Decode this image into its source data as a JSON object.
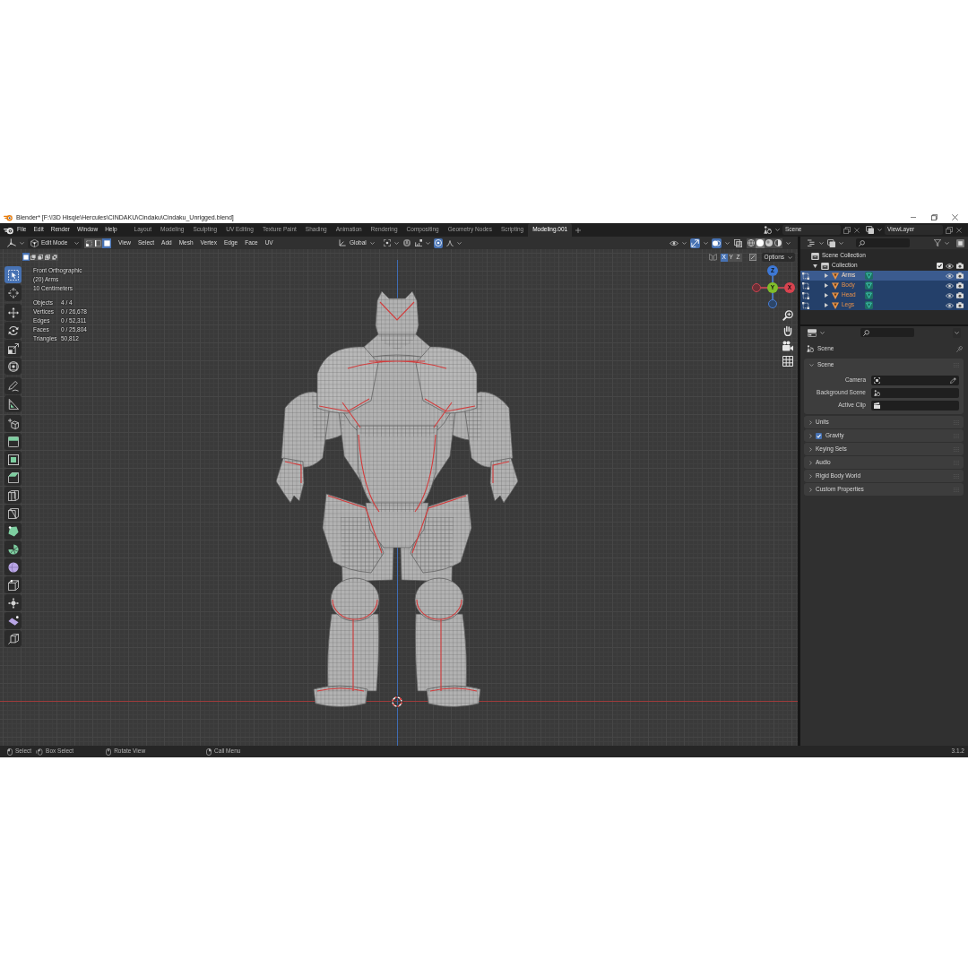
{
  "window": {
    "title": "Blender* [F:\\!3D Hisqie\\Hercules\\CINDAKU\\Cindaku\\Cindaku_Unrigged.blend]"
  },
  "menu_bar": [
    "File",
    "Edit",
    "Render",
    "Window",
    "Help"
  ],
  "workspace_tabs": [
    {
      "label": "Layout",
      "selected": false
    },
    {
      "label": "Modeling",
      "selected": false
    },
    {
      "label": "Sculpting",
      "selected": false
    },
    {
      "label": "UV Editing",
      "selected": false
    },
    {
      "label": "Texture Paint",
      "selected": false
    },
    {
      "label": "Shading",
      "selected": false
    },
    {
      "label": "Animation",
      "selected": false
    },
    {
      "label": "Rendering",
      "selected": false
    },
    {
      "label": "Compositing",
      "selected": false
    },
    {
      "label": "Geometry Nodes",
      "selected": false
    },
    {
      "label": "Scripting",
      "selected": false
    },
    {
      "label": "Modeling.001",
      "selected": true
    }
  ],
  "scene_selector": {
    "value": "Scene"
  },
  "view_layer_selector": {
    "value": "ViewLayer"
  },
  "viewport_header": {
    "mode": "Edit Mode",
    "select_modes": [
      {
        "selected": false
      },
      {
        "selected": false
      },
      {
        "selected": true
      }
    ],
    "menus": [
      "View",
      "Select",
      "Add",
      "Mesh",
      "Vertex",
      "Edge",
      "Face",
      "UV"
    ],
    "transform_orientation": "Global",
    "snap": {
      "on": false
    },
    "proportional_editing": {
      "on": true
    },
    "gizmos": {
      "on": true
    },
    "overlays": {
      "on": true
    },
    "xray": {
      "on": false
    },
    "shading_modes": [
      {
        "selected": false
      },
      {
        "selected": true
      },
      {
        "selected": false
      },
      {
        "selected": false
      }
    ]
  },
  "tool_header": {
    "selection_modes": [
      {
        "selected": true
      },
      {
        "selected": false
      },
      {
        "selected": false
      },
      {
        "selected": false
      },
      {
        "selected": false
      }
    ],
    "mirror_axes": [
      {
        "label": "X",
        "selected": true
      },
      {
        "label": "Y",
        "selected": false
      },
      {
        "label": "Z",
        "selected": false
      }
    ],
    "options": "Options"
  },
  "viewport_info": {
    "view": "Front Orthographic",
    "object": "(20) Arms",
    "grid_scale": "10 Centimeters",
    "stats": [
      {
        "label": "Objects",
        "value": "4 / 4"
      },
      {
        "label": "Vertices",
        "value": "0 / 26,678"
      },
      {
        "label": "Edges",
        "value": "0 / 52,311"
      },
      {
        "label": "Faces",
        "value": "0 / 25,804"
      },
      {
        "label": "Triangles",
        "value": "50,812"
      }
    ]
  },
  "toolbar": [
    {
      "selected": true
    },
    {
      "selected": false
    },
    {
      "selected": false
    },
    {
      "selected": false
    },
    {
      "selected": false
    },
    {
      "selected": false
    },
    {
      "selected": false
    },
    {
      "selected": false
    },
    {
      "selected": false
    },
    {
      "selected": false
    },
    {
      "selected": false
    },
    {
      "selected": false
    },
    {
      "selected": false
    },
    {
      "selected": false
    },
    {
      "selected": false
    },
    {
      "selected": false
    },
    {
      "selected": false
    },
    {
      "selected": false
    },
    {
      "selected": false
    },
    {
      "selected": false
    },
    {
      "selected": false
    }
  ],
  "navigation_gizmo": {
    "axes": [
      "Z",
      "Y",
      "X"
    ]
  },
  "outliner": {
    "root": {
      "kind": "scene_collection",
      "label": "Scene Collection",
      "children": [
        {
          "kind": "collection",
          "label": "Collection",
          "expanded": true,
          "checked": true,
          "selected": false,
          "children": [
            {
              "kind": "mesh",
              "label": "Arms",
              "expanded": false,
              "selected": true,
              "active": true
            },
            {
              "kind": "mesh",
              "label": "Body",
              "expanded": false,
              "selected": true,
              "active": false
            },
            {
              "kind": "mesh",
              "label": "Head",
              "expanded": false,
              "selected": true,
              "active": false
            },
            {
              "kind": "mesh",
              "label": "Legs",
              "expanded": false,
              "selected": true,
              "active": false
            }
          ]
        }
      ]
    }
  },
  "properties": {
    "context": "Scene",
    "panels": [
      {
        "kind": "plain",
        "title": "Scene",
        "expanded": true,
        "fields": [
          {
            "kind": "object",
            "label": "Camera"
          },
          {
            "kind": "scene",
            "label": "Background Scene"
          },
          {
            "kind": "clip",
            "label": "Active Clip"
          }
        ]
      },
      {
        "kind": "plain",
        "title": "Units",
        "expanded": false
      },
      {
        "kind": "checkbox",
        "title": "Gravity",
        "checked": true,
        "expanded": false
      },
      {
        "kind": "plain",
        "title": "Keying Sets",
        "expanded": false
      },
      {
        "kind": "plain",
        "title": "Audio",
        "expanded": false
      },
      {
        "kind": "plain",
        "title": "Rigid Body World",
        "expanded": false
      },
      {
        "kind": "plain",
        "title": "Custom Properties",
        "expanded": false
      }
    ]
  },
  "status_bar": {
    "hints": [
      {
        "kind": "left_click",
        "label": "Select"
      },
      {
        "kind": "drag",
        "label": "Box Select"
      },
      {
        "kind": "middle_click",
        "label": "Rotate View"
      },
      {
        "kind": "right_click",
        "label": "Call Menu"
      }
    ],
    "version": "3.1.2"
  }
}
